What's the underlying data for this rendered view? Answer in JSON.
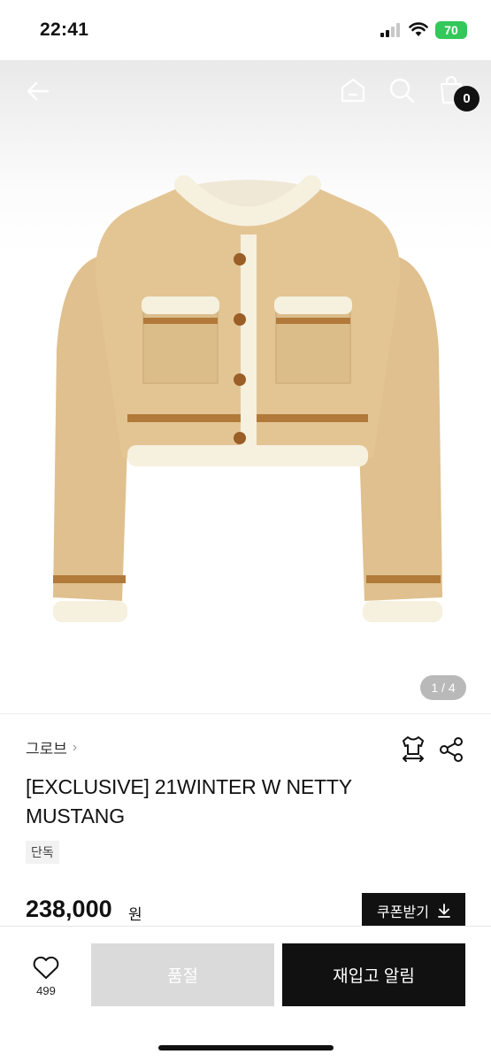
{
  "status_bar": {
    "time": "22:41",
    "battery": "70"
  },
  "header": {
    "cart_count": "0"
  },
  "gallery": {
    "counter": "1 / 4"
  },
  "product": {
    "brand": "그로브",
    "title": "[EXCLUSIVE] 21WINTER W NETTY MUSTANG",
    "badge": "단독",
    "price": "238,000",
    "price_unit": "원",
    "coupon_label": "쿠폰받기"
  },
  "bottom_bar": {
    "like_count": "499",
    "soldout_label": "품절",
    "restock_label": "재입고 알림"
  },
  "colors": {
    "jacket": "#e0c190",
    "trim": "#f5efdf",
    "stripe": "#b27a3a",
    "button": "#9a5e26"
  }
}
